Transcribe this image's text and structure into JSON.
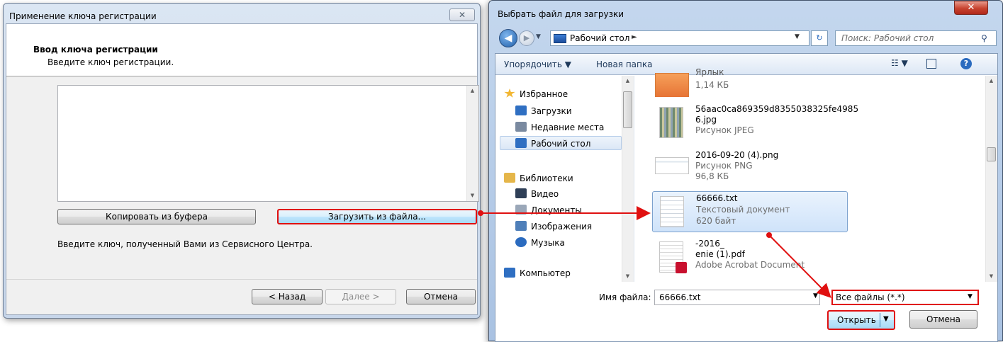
{
  "dialog_left": {
    "title": "Применение ключа регистрации",
    "close_glyph": "✕",
    "header_title": "Ввод ключа регистрации",
    "header_subtitle": "Введите ключ регистрации.",
    "copy_button": "Копировать из буфера",
    "load_button": "Загрузить из файла...",
    "hint": "Введите ключ, полученный Вами из Сервисного Центра.",
    "back_button": "< Назад",
    "next_button": "Далее >",
    "cancel_button": "Отмена"
  },
  "dialog_right": {
    "title": "Выбрать файл для загрузки",
    "close_glyph": "✕",
    "address_location": "Рабочий стол",
    "address_caret": "►",
    "search_placeholder": "Поиск: Рабочий стол",
    "toolbar": {
      "organize": "Упорядочить ▼",
      "new_folder": "Новая папка",
      "views": "☷ ▼",
      "help": "?"
    },
    "nav_items": [
      {
        "label": "Избранное",
        "icon": "star-icon",
        "color": "#f2b632"
      },
      {
        "label": "Загрузки",
        "icon": "downloads-folder-icon",
        "color": "#2f6fc2"
      },
      {
        "label": "Недавние места",
        "icon": "recent-places-icon",
        "color": "#7a8aa0"
      },
      {
        "label": "Рабочий стол",
        "icon": "desktop-icon",
        "color": "#2f6fc2"
      },
      {
        "label": "Библиотеки",
        "icon": "libraries-icon",
        "color": "#e5b64a"
      },
      {
        "label": "Видео",
        "icon": "video-icon",
        "color": "#2f3f57"
      },
      {
        "label": "Документы",
        "icon": "documents-icon",
        "color": "#9aa7b8"
      },
      {
        "label": "Изображения",
        "icon": "images-icon",
        "color": "#4f7fb9"
      },
      {
        "label": "Музыка",
        "icon": "music-icon",
        "color": "#2b6bbf"
      },
      {
        "label": "Компьютер",
        "icon": "computer-icon",
        "color": "#2f6fc2"
      }
    ],
    "files": [
      {
        "name": "Ярлык",
        "details": [
          "1,14 КБ"
        ],
        "icon": "shortcut-icon"
      },
      {
        "name": "56aac0ca869359d8355038325fe4985\n6.jpg",
        "details": [
          "Рисунок JPEG"
        ],
        "icon": "jpeg-thumbnail-icon"
      },
      {
        "name": "2016-09-20 (4).png",
        "details": [
          "Рисунок PNG",
          "96,8 КБ"
        ],
        "icon": "png-thumbnail-icon"
      },
      {
        "name": "66666.txt",
        "details": [
          "Текстовый документ",
          "620 байт"
        ],
        "icon": "text-file-icon"
      },
      {
        "name": "-2016_\nenie (1).pdf",
        "details": [
          "Adobe Acrobat Document"
        ],
        "icon": "pdf-file-icon"
      }
    ],
    "filename_label": "Имя файла:",
    "filename_value": "66666.txt",
    "filter_value": "Все файлы (*.*)",
    "open_button": "Открыть",
    "cancel_button": "Отмена"
  },
  "colors": {
    "highlight_red": "#e01010",
    "selection_blue": "#cfe3fa"
  }
}
